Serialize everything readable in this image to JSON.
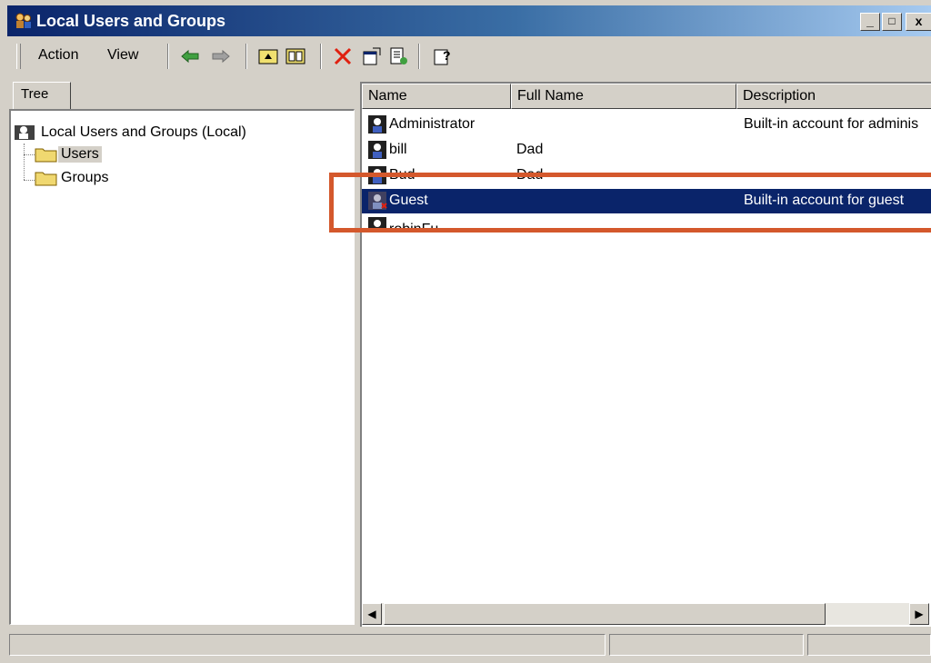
{
  "window": {
    "title": "Local Users and Groups",
    "controls": [
      "_",
      "□",
      "x"
    ]
  },
  "toolbar": {
    "menus": [
      "Action",
      "View"
    ],
    "tools": [
      "back-arrow-icon",
      "forward-arrow-icon",
      "up-folder-icon",
      "show-hide-tree-icon",
      "delete-icon",
      "properties-icon",
      "export-list-icon",
      "help-icon"
    ]
  },
  "tree": {
    "tab_label": "Tree",
    "root": "Local Users and Groups (Local)",
    "children": [
      {
        "label": "Users",
        "selected": true
      },
      {
        "label": "Groups",
        "selected": false
      }
    ]
  },
  "list": {
    "columns": [
      "Name",
      "Full Name",
      "Description"
    ],
    "rows": [
      {
        "name": "Administrator",
        "full_name": "",
        "description": "Built-in account for adminis"
      },
      {
        "name": "bill",
        "full_name": "Dad",
        "description": ""
      },
      {
        "name": "Bud",
        "full_name": "Dad",
        "description": ""
      },
      {
        "name": "Guest",
        "full_name": "",
        "description": "Built-in account for guest",
        "selected": true
      },
      {
        "name": "robinFu",
        "full_name": "",
        "description": ""
      }
    ]
  },
  "annotation": {
    "color": "#d4582c"
  },
  "colors": {
    "selection": "#0a246a",
    "title_start": "#0a246a",
    "title_end": "#a6caf0",
    "face": "#d4d0c8"
  }
}
